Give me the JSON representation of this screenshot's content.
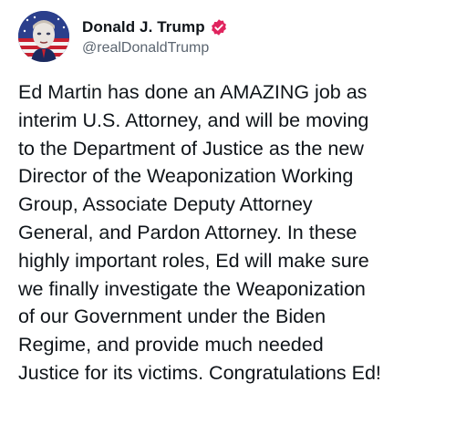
{
  "author": {
    "display_name": "Donald J. Trump",
    "handle": "@realDonaldTrump",
    "avatar_icon": "profile-avatar",
    "verified_icon": "verified-badge-icon",
    "verified_color": "#e0245e"
  },
  "post": {
    "text": "Ed Martin has done an AMAZING job as\ninterim U.S. Attorney, and will be moving\nto the Department of Justice as the new\nDirector of the Weaponization Working\nGroup, Associate Deputy Attorney\nGeneral, and Pardon Attorney. In these\nhighly important roles, Ed will make sure\nwe finally investigate the Weaponization\nof our Government under the Biden\nRegime, and provide much needed\nJustice for its victims. Congratulations Ed!"
  }
}
